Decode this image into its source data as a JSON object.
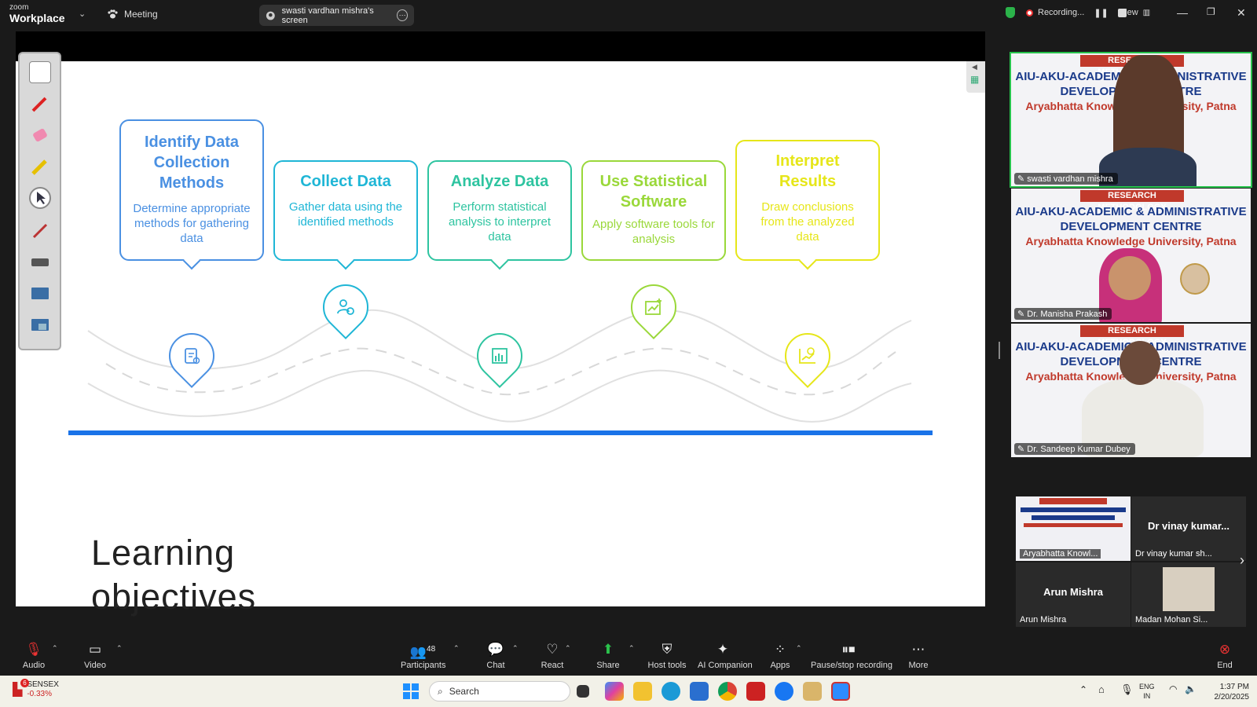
{
  "titlebar": {
    "logo_small": "zoom",
    "logo_big": "Workplace",
    "meeting_label": "Meeting",
    "share_pill": "swasti vardhan mishra's screen",
    "recording_label": "Recording...",
    "view_label": "View"
  },
  "slide": {
    "steps": [
      {
        "title": "Identify Data Collection Methods",
        "desc": "Determine appropriate methods for gathering data",
        "color": "#4a90e2"
      },
      {
        "title": "Collect Data",
        "desc": "Gather data using the identified methods",
        "color": "#1fb6d6"
      },
      {
        "title": "Analyze Data",
        "desc": "Perform statistical analysis to interpret data",
        "color": "#2ec4a0"
      },
      {
        "title": "Use Statistical Software",
        "desc": "Apply software tools for analysis",
        "color": "#9ad83a"
      },
      {
        "title": "Interpret Results",
        "desc": "Draw conclusions from the analyzed data",
        "color": "#e6e619"
      }
    ],
    "heading_line1": "Learning",
    "heading_line2": "objectives"
  },
  "participants_video": [
    {
      "name": "swasti vardhan mishra"
    },
    {
      "name": "Dr. Manisha Prakash"
    },
    {
      "name": "Dr. Sandeep Kumar Dubey"
    }
  ],
  "banner": {
    "tag": "RESEARCH METHODOLOGY",
    "line1": "AIU-AKU-ACADEMIC & ADMINISTRATIVE",
    "line2": "DEVELOPMENT CENTRE",
    "line3": "Aryabhatta Knowledge University, Patna"
  },
  "mini_tiles": [
    {
      "name": "Aryabhatta Knowl..."
    },
    {
      "name": "Dr vinay kumar sh...",
      "center": "Dr vinay kumar..."
    },
    {
      "name": "Arun Mishra",
      "center": "Arun Mishra"
    },
    {
      "name": "Madan Mohan Si..."
    }
  ],
  "toolbar": {
    "audio": "Audio",
    "video": "Video",
    "participants": "Participants",
    "participants_count": "48",
    "chat": "Chat",
    "react": "React",
    "share": "Share",
    "host_tools": "Host tools",
    "ai_companion": "AI Companion",
    "apps": "Apps",
    "pause_stop": "Pause/stop recording",
    "more": "More",
    "end": "End"
  },
  "taskbar": {
    "ticker_name": "SENSEX",
    "ticker_change": "-0.33%",
    "ticker_badge": "6",
    "search_placeholder": "Search",
    "lang1": "ENG",
    "lang2": "IN",
    "time": "1:37 PM",
    "date": "2/20/2025"
  }
}
